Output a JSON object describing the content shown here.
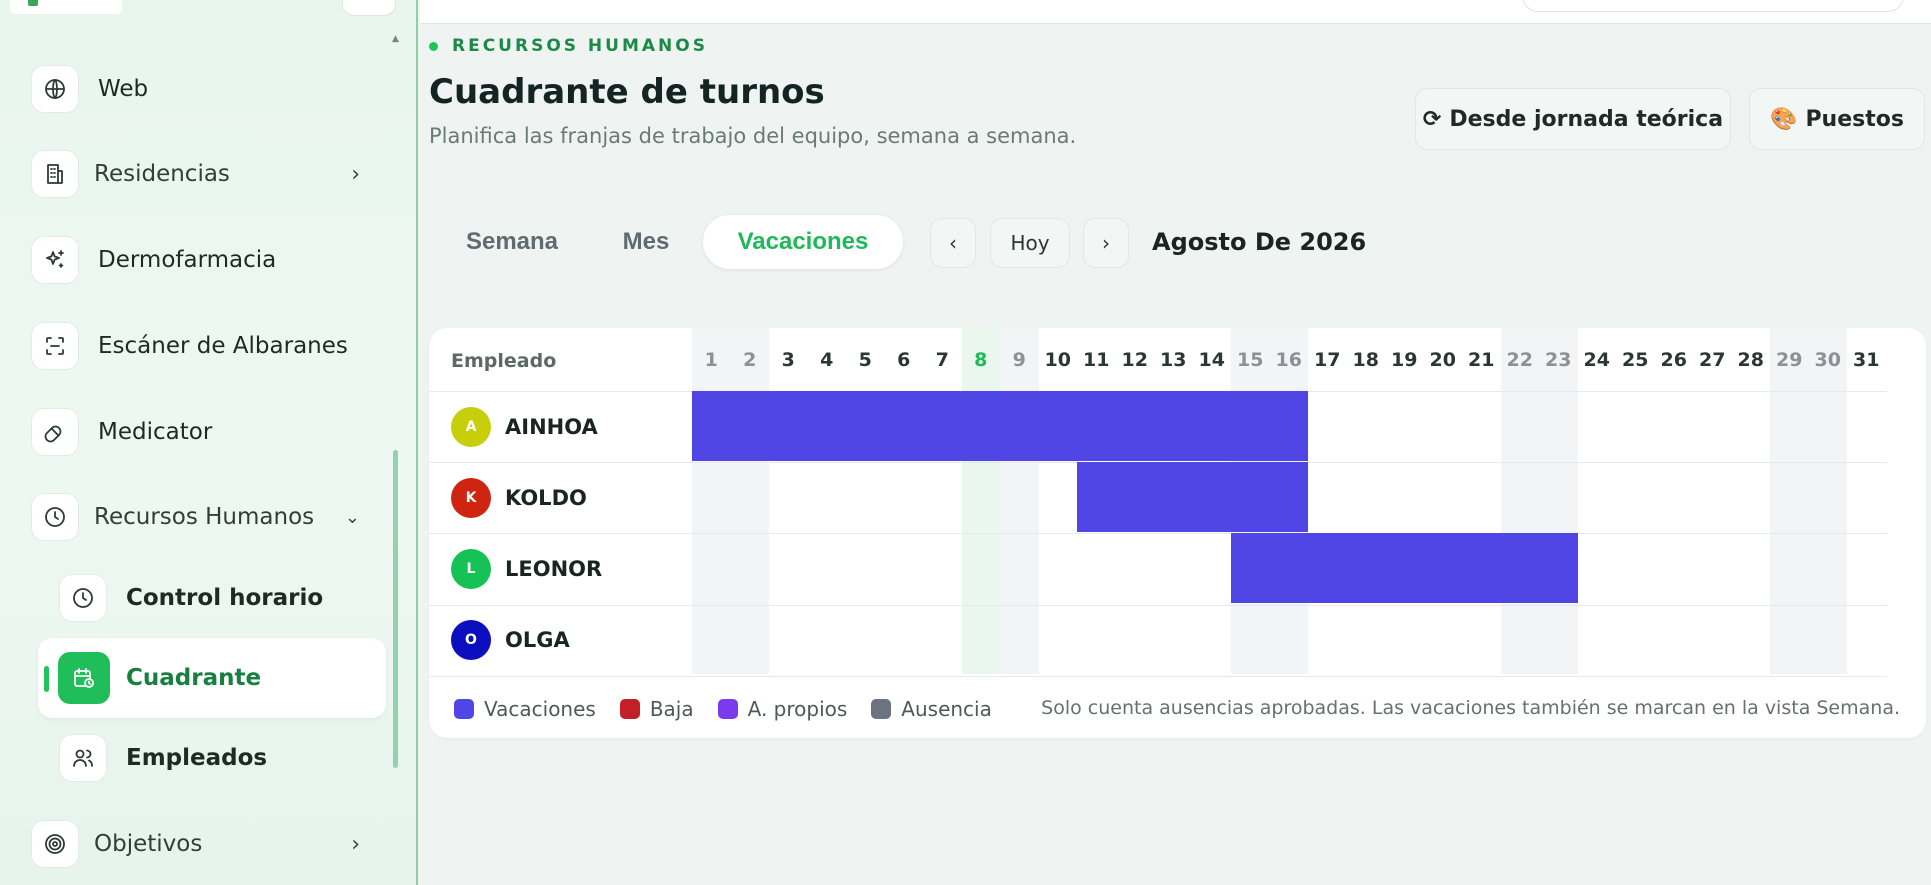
{
  "sidebar": {
    "items": [
      {
        "label": "Web",
        "icon": "globe-icon"
      },
      {
        "label": "Residencias",
        "icon": "building-icon"
      },
      {
        "label": "Dermofarmacia",
        "icon": "sparkles-icon"
      },
      {
        "label": "Escáner de Albaranes",
        "icon": "scan-icon"
      },
      {
        "label": "Medicator",
        "icon": "pill-icon"
      },
      {
        "label": "Recursos Humanos",
        "icon": "clock-icon"
      },
      {
        "label": "Objetivos",
        "icon": "target-icon"
      }
    ],
    "subitems": [
      {
        "label": "Control horario",
        "icon": "clock-icon"
      },
      {
        "label": "Cuadrante",
        "icon": "calendar-clock-icon",
        "active": true
      },
      {
        "label": "Empleados",
        "icon": "users-icon"
      }
    ]
  },
  "header": {
    "eyebrow": "RECURSOS HUMANOS",
    "title": "Cuadrante de turnos",
    "subtitle": "Planifica las franjas de trabajo del equipo, semana a semana.",
    "btn_jornada": "Desde jornada teórica",
    "btn_puestos": "Puestos"
  },
  "toolbar": {
    "tabs": [
      "Semana",
      "Mes",
      "Vacaciones"
    ],
    "active_tab": "Vacaciones",
    "prev": "‹",
    "today": "Hoy",
    "next": "›",
    "period": "Agosto De 2026"
  },
  "calendar": {
    "employee_col_label": "Empleado",
    "days": [
      1,
      2,
      3,
      4,
      5,
      6,
      7,
      8,
      9,
      10,
      11,
      12,
      13,
      14,
      15,
      16,
      17,
      18,
      19,
      20,
      21,
      22,
      23,
      24,
      25,
      26,
      27,
      28,
      29,
      30,
      31
    ],
    "weekend_days": [
      1,
      2,
      8,
      9,
      15,
      16,
      22,
      23,
      29,
      30
    ],
    "today_day": 8,
    "employees": [
      {
        "initial": "A",
        "name": "AINHOA",
        "color": "#c7cf0a",
        "absences": [
          {
            "type": "Vacaciones",
            "from": 1,
            "to": 16
          }
        ]
      },
      {
        "initial": "K",
        "name": "KOLDO",
        "color": "#cf2410",
        "absences": [
          {
            "type": "Vacaciones",
            "from": 11,
            "to": 16
          }
        ]
      },
      {
        "initial": "L",
        "name": "LEONOR",
        "color": "#16c256",
        "absences": [
          {
            "type": "Vacaciones",
            "from": 15,
            "to": 23
          }
        ]
      },
      {
        "initial": "O",
        "name": "OLGA",
        "color": "#0c0fbf",
        "absences": []
      }
    ]
  },
  "legend": {
    "items": [
      {
        "label": "Vacaciones",
        "color": "#5046e6"
      },
      {
        "label": "Baja",
        "color": "#c21f26"
      },
      {
        "label": "A. propios",
        "color": "#7c3aed"
      },
      {
        "label": "Ausencia",
        "color": "#6b7280"
      }
    ],
    "note": "Solo cuenta ausencias aprobadas. Las vacaciones también se marcan en la vista Semana."
  }
}
